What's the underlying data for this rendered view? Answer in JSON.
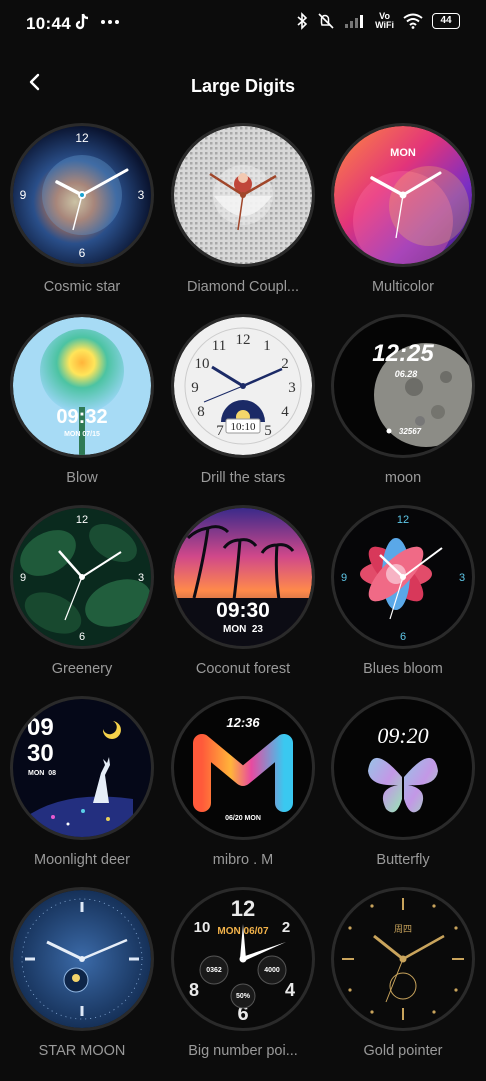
{
  "status_bar": {
    "time": "10:44",
    "vowifi": [
      "Vo",
      "WiFi"
    ],
    "battery": "44"
  },
  "header": {
    "title": "Large Digits"
  },
  "faces": [
    {
      "name": "Cosmic star",
      "digits": [
        "12",
        "3",
        "6",
        "9"
      ]
    },
    {
      "name": "Diamond Coupl..."
    },
    {
      "name": "Multicolor",
      "brand": "MON"
    },
    {
      "name": "Blow",
      "time": "09:32",
      "date": "MON 07/15"
    },
    {
      "name": "Drill the stars",
      "numerals": [
        "12",
        "1",
        "2",
        "3",
        "4",
        "5",
        "6",
        "7",
        "8",
        "9",
        "10",
        "11"
      ],
      "date": "10:10"
    },
    {
      "name": "moon",
      "time": "12:25",
      "date": "06.28",
      "steps": "32567"
    },
    {
      "name": "Greenery",
      "digits": [
        "12",
        "3",
        "6",
        "9"
      ]
    },
    {
      "name": "Coconut forest",
      "time": "09:30",
      "date": "MON  23"
    },
    {
      "name": "Blues bloom",
      "digits": [
        "12",
        "3",
        "6",
        "9"
      ]
    },
    {
      "name": "Moonlight deer",
      "hour": "09",
      "minute": "30",
      "date": "MON  08"
    },
    {
      "name": "mibro . M",
      "time": "12:36",
      "date": "06/20 MON"
    },
    {
      "name": "Butterfly",
      "time": "09:20"
    },
    {
      "name": "STAR MOON"
    },
    {
      "name": "Big number poi...",
      "date": "MON 06/07",
      "digits": [
        "12",
        "10",
        "2",
        "8",
        "4",
        "6"
      ],
      "left_value": "0362",
      "right_value": "4000",
      "battery": "50%"
    },
    {
      "name": "Gold pointer",
      "day": "周四"
    }
  ]
}
